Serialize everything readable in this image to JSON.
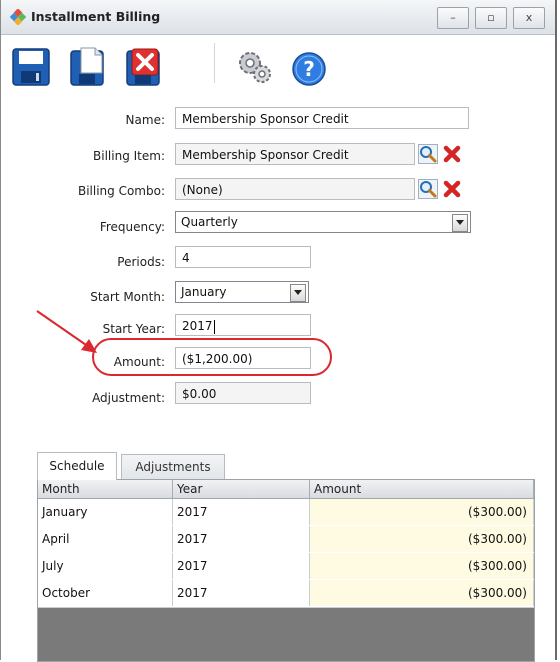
{
  "window": {
    "title": "Installment Billing",
    "controls": {
      "minimize": "–",
      "maximize": "▫",
      "close": "x"
    }
  },
  "toolbar": {
    "buttons": [
      {
        "name": "save",
        "icon": "save-icon"
      },
      {
        "name": "save-and-new",
        "icon": "save-new-icon"
      },
      {
        "name": "delete",
        "icon": "delete-icon"
      },
      {
        "name": "settings",
        "icon": "gears-icon"
      },
      {
        "name": "help",
        "icon": "help-icon"
      }
    ]
  },
  "form": {
    "name": {
      "label": "Name:",
      "value": "Membership Sponsor Credit"
    },
    "billing_item": {
      "label": "Billing Item:",
      "value": "Membership Sponsor Credit"
    },
    "billing_combo": {
      "label": "Billing Combo:",
      "value": "(None)"
    },
    "frequency": {
      "label": "Frequency:",
      "value": "Quarterly"
    },
    "periods": {
      "label": "Periods:",
      "value": "4"
    },
    "start_month": {
      "label": "Start Month:",
      "value": "January"
    },
    "start_year": {
      "label": "Start Year:",
      "value": "2017"
    },
    "amount": {
      "label": "Amount:",
      "value": "($1,200.00)"
    },
    "adjustment": {
      "label": "Adjustment:",
      "value": "$0.00"
    }
  },
  "annotation": {
    "color": "#d9282f"
  },
  "tabs": [
    {
      "label": "Schedule",
      "active": true
    },
    {
      "label": "Adjustments",
      "active": false
    }
  ],
  "schedule": {
    "columns": [
      "Month",
      "Year",
      "Amount"
    ],
    "rows": [
      {
        "month": "January",
        "year": "2017",
        "amount": "($300.00)"
      },
      {
        "month": "April",
        "year": "2017",
        "amount": "($300.00)"
      },
      {
        "month": "July",
        "year": "2017",
        "amount": "($300.00)"
      },
      {
        "month": "October",
        "year": "2017",
        "amount": "($300.00)"
      }
    ]
  }
}
